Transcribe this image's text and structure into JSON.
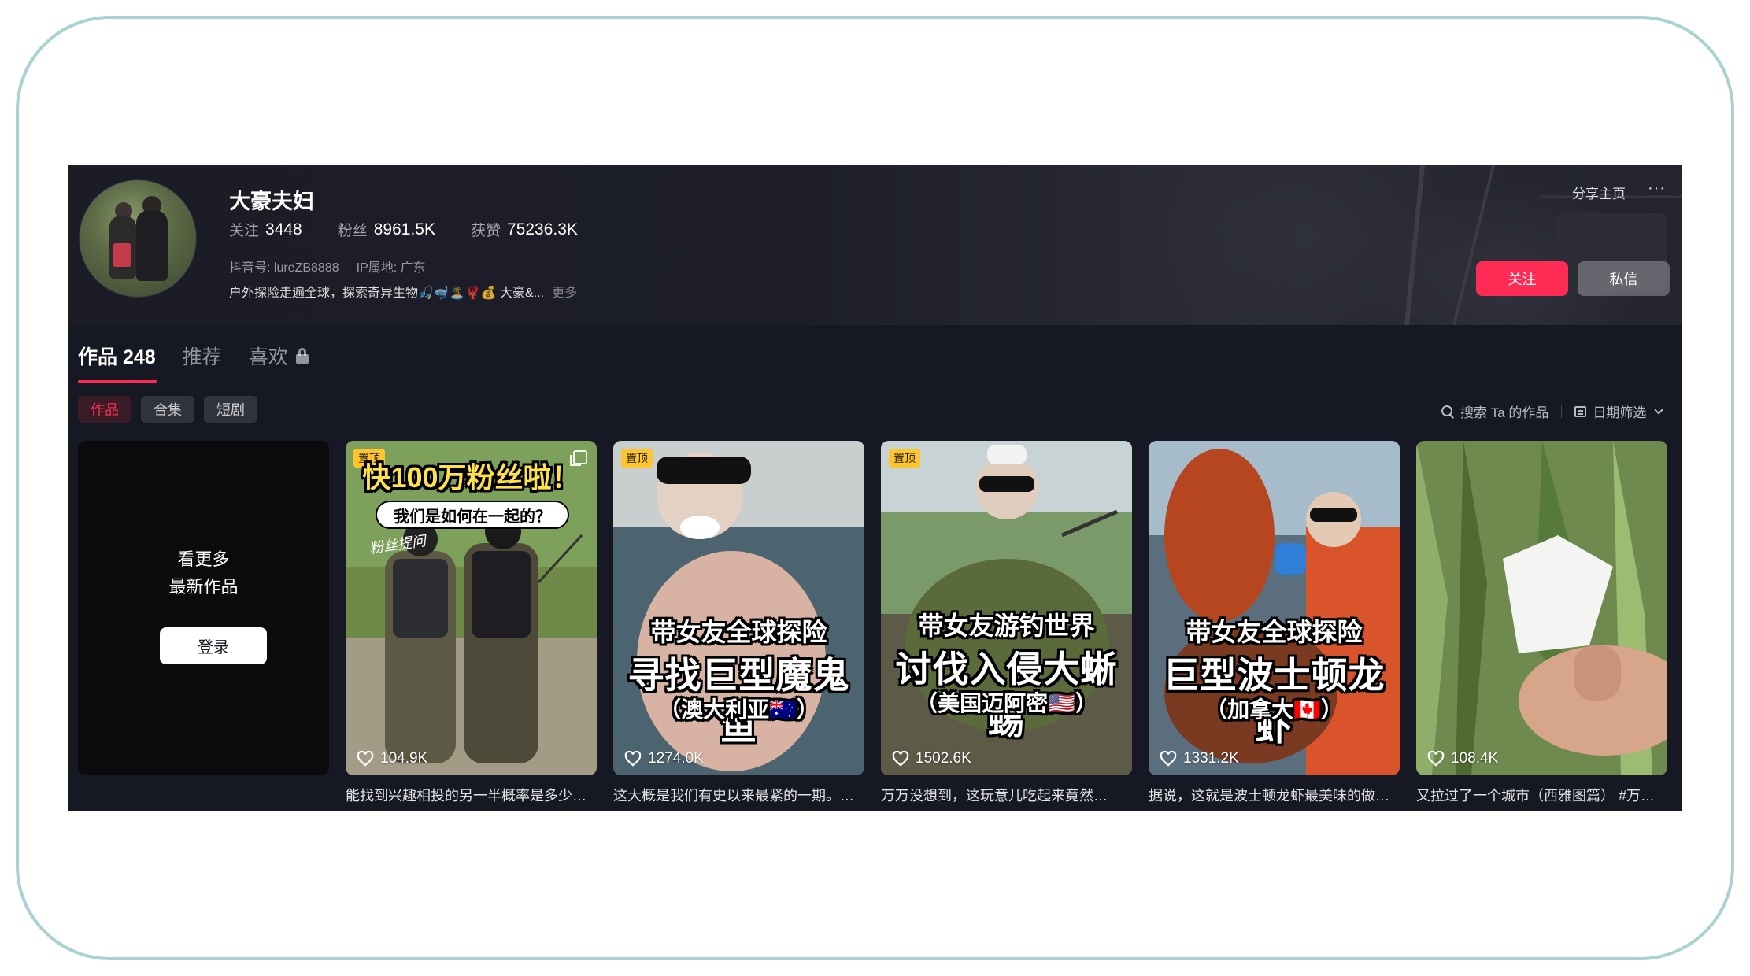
{
  "profile": {
    "name": "大豪夫妇",
    "following_label": "关注",
    "following_value": "3448",
    "followers_label": "粉丝",
    "followers_value": "8961.5K",
    "likes_label": "获赞",
    "likes_value": "75236.3K",
    "douyin_id": "抖音号: lureZB8888",
    "ip_location": "IP属地: 广东",
    "bio": "户外探险走遍全球，探索奇异生物🎣🤿🏝️🦞💰 大豪&...",
    "bio_more": "更多"
  },
  "header_actions": {
    "share": "分享主页",
    "more": "···",
    "follow": "关注",
    "message": "私信"
  },
  "tabs": [
    {
      "label": "作品 248"
    },
    {
      "label": "推荐"
    },
    {
      "label": "喜欢"
    }
  ],
  "subtabs": [
    {
      "label": "作品"
    },
    {
      "label": "合集"
    },
    {
      "label": "短剧"
    }
  ],
  "toolbar": {
    "search": "搜索 Ta 的作品",
    "date_filter": "日期筛选"
  },
  "login_card": {
    "line1": "看更多",
    "line2": "最新作品",
    "button": "登录"
  },
  "videos": [
    {
      "pinned": "置顶",
      "overlay_top": "快100万粉丝啦！",
      "overlay_bubble": "我们是如何在一起的？",
      "overlay_note": "粉丝提问",
      "likes": "104.9K",
      "caption": "能找到兴趣相投的另一半概率是多少…"
    },
    {
      "pinned": "置顶",
      "overlay_top": "带女友全球探险",
      "overlay_main": "寻找巨型魔鬼鱼",
      "overlay_sub": "（澳大利亚🇦🇺）",
      "likes": "1274.0K",
      "caption": "这大概是我们有史以来最紧的一期。…"
    },
    {
      "pinned": "置顶",
      "overlay_top": "带女友游钓世界",
      "overlay_main": "讨伐入侵大蜥蜴",
      "overlay_sub": "（美国迈阿密🇺🇸）",
      "likes": "1502.6K",
      "caption": "万万没想到，这玩意儿吃起来竟然…"
    },
    {
      "overlay_top": "带女友全球探险",
      "overlay_main": "巨型波士顿龙虾",
      "overlay_sub": "（加拿大🇨🇦）",
      "likes": "1331.2K",
      "caption": "据说，这就是波士顿龙虾最美味的做…"
    },
    {
      "likes": "108.4K",
      "caption": "又拉过了一个城市（西雅图篇） #万…"
    }
  ],
  "colors": {
    "accent": "#fe2c55",
    "background": "#161823",
    "pin": "#fec62e",
    "frame": "#a9d3d2"
  }
}
